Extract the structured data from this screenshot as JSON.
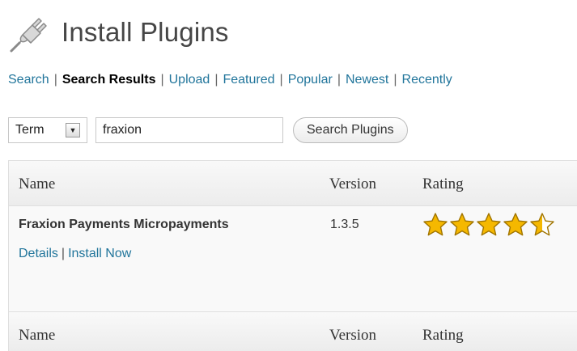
{
  "header": {
    "icon": "plugin-plug-icon",
    "title": "Install Plugins"
  },
  "subnav": {
    "items": [
      {
        "label": "Search",
        "current": false
      },
      {
        "label": "Search Results",
        "current": true
      },
      {
        "label": "Upload",
        "current": false
      },
      {
        "label": "Featured",
        "current": false
      },
      {
        "label": "Popular",
        "current": false
      },
      {
        "label": "Newest",
        "current": false
      },
      {
        "label": "Recently",
        "current": false
      }
    ],
    "separator": "|"
  },
  "search": {
    "type_selected": "Term",
    "query": "fraxion",
    "button_label": "Search Plugins"
  },
  "table": {
    "columns": {
      "name": "Name",
      "version": "Version",
      "rating": "Rating"
    },
    "rows": [
      {
        "name": "Fraxion Payments Micropayments",
        "version": "1.3.5",
        "rating": 4.5,
        "rating_max": 5,
        "actions": {
          "details": "Details",
          "install": "Install Now",
          "separator": "|"
        }
      }
    ]
  },
  "colors": {
    "link": "#21759b",
    "star_fill": "#f5b800",
    "star_outline": "#a07400"
  }
}
